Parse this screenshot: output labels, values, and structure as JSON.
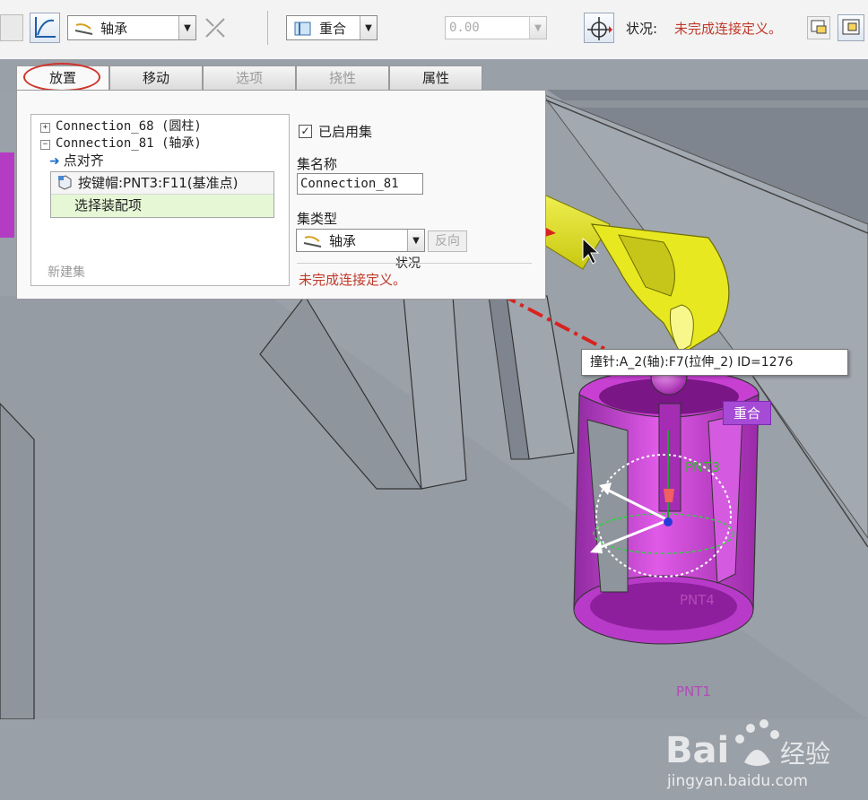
{
  "toolbar": {
    "connection_type": "轴承",
    "constraint_type": "重合",
    "offset_value": "0.00",
    "status_label": "状况:",
    "status_text": "未完成连接定义。"
  },
  "tabs": [
    {
      "label": "放置",
      "state": "active"
    },
    {
      "label": "移动",
      "state": "enabled"
    },
    {
      "label": "选项",
      "state": "disabled"
    },
    {
      "label": "挠性",
      "state": "disabled"
    },
    {
      "label": "属性",
      "state": "enabled"
    }
  ],
  "panel": {
    "tree": {
      "conn1": "Connection_68 (圆柱)",
      "conn2": "Connection_81 (轴承)",
      "constraint": "点对齐",
      "ref1": "按键帽:PNT3:F11(基准点)",
      "ref2": "选择装配项",
      "new_set": "新建集"
    },
    "enabled_set_label": "已启用集",
    "set_name_label": "集名称",
    "set_name_value": "Connection_81",
    "set_type_label": "集类型",
    "set_type_value": "轴承",
    "flip_label": "反向",
    "status_heading": "状况",
    "status_text": "未完成连接定义。"
  },
  "viewport": {
    "tooltip": "撞针:A_2(轴):F7(拉伸_2) ID=1276",
    "coincident_tag": "重合",
    "points": [
      "PNT3",
      "PNT4",
      "PNT1"
    ]
  },
  "watermark": {
    "brand": "Bai",
    "brand_cn": "经验",
    "url": "jingyan.baidu.com"
  },
  "colors": {
    "status_red": "#c0392b",
    "purple_part": "#c33ad1",
    "yellow_part": "#e8e821",
    "tag_purple": "#a64bd6",
    "arrow_red": "#d8231f"
  }
}
